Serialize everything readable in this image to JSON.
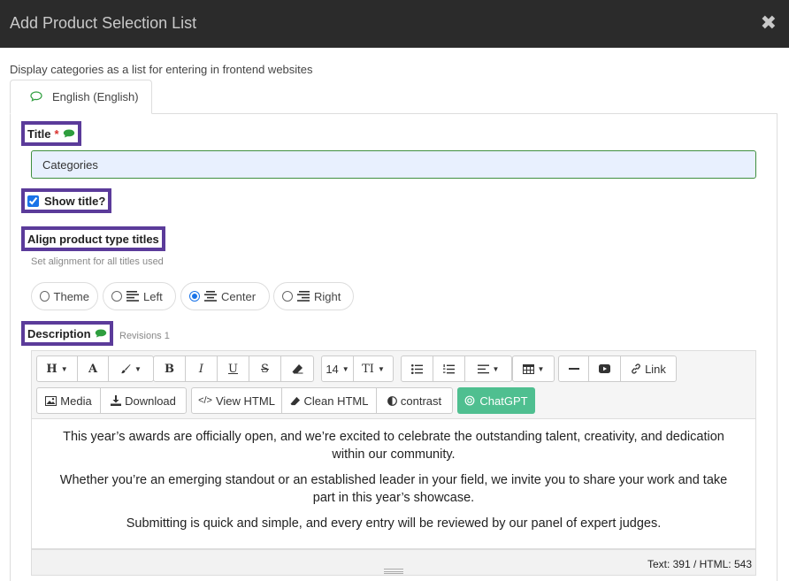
{
  "dialog": {
    "title": "Add Product Selection List",
    "close_label": "✖"
  },
  "subtitle": "Display categories as a list for entering in frontend websites",
  "tab": {
    "label": "English (English)"
  },
  "title_field": {
    "label": "Title",
    "required_mark": "*",
    "value": "Categories"
  },
  "show_title": {
    "label": "Show title?",
    "checked": true
  },
  "align": {
    "label": "Align product type titles",
    "hint": "Set alignment for all titles used",
    "options": [
      {
        "label": "Theme",
        "selected": false
      },
      {
        "label": "Left",
        "selected": false
      },
      {
        "label": "Center",
        "selected": true
      },
      {
        "label": "Right",
        "selected": false
      }
    ]
  },
  "description": {
    "label": "Description",
    "revisions": "Revisions 1",
    "toolbar": {
      "font_size": "14",
      "link": "Link",
      "media": "Media",
      "download": "Download",
      "view_html": "View HTML",
      "clean_html": "Clean HTML",
      "contrast": "contrast",
      "chatgpt": "ChatGPT"
    },
    "paragraphs": [
      "This year’s awards are officially open, and we’re excited to celebrate the outstanding talent, creativity, and dedication within our community.",
      "Whether you’re an emerging standout or an established leader in your field, we invite you to share your work and take part in this year’s showcase.",
      "Submitting is quick and simple, and every entry will be reviewed by our panel of expert judges."
    ],
    "counts": "Text: 391 / HTML: 543"
  },
  "colors": {
    "header_bg": "#2b2b2b",
    "label_highlight": "#5b3b9a",
    "chatgpt": "#4fbf90",
    "speech_green": "#2e9e3e"
  }
}
